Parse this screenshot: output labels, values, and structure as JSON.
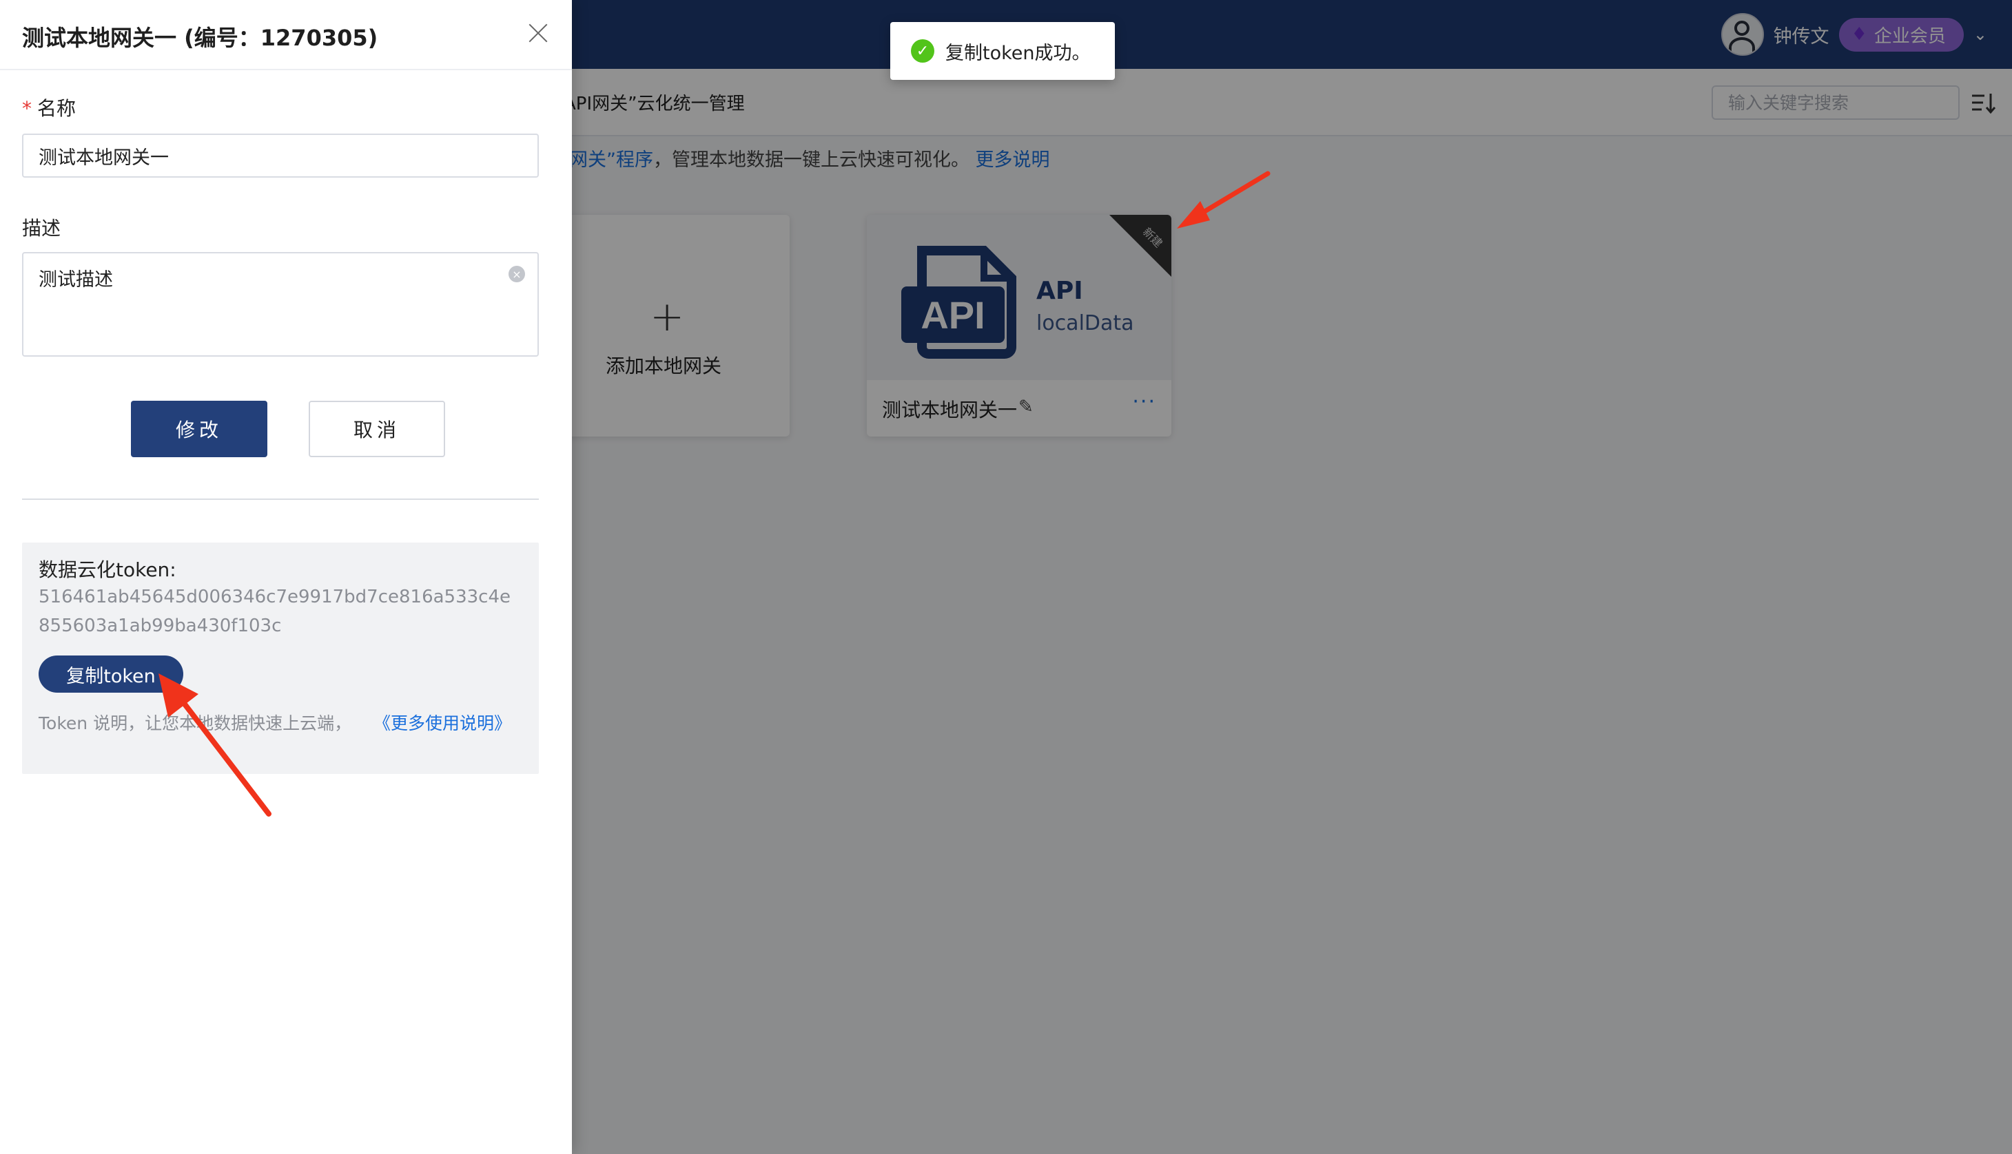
{
  "topbar": {
    "user_name": "钟传文",
    "vip_label": "企业会员",
    "colors": {
      "bar": "#1e3a73",
      "badge": "#8e67d9"
    }
  },
  "subbar": {
    "title": "API网关”云化统一管理",
    "search_placeholder": "输入关键字搜索"
  },
  "info": {
    "prefix": "I网关”程序",
    "text": "，管理本地数据一键上云快速可视化。",
    "link": "更多说明"
  },
  "cards": {
    "add_label": "添加本地网关",
    "gateway": {
      "api_title": "API",
      "api_subtitle": "localData",
      "logo_text": "API",
      "new_tag": "新建",
      "name": "测试本地网关一"
    }
  },
  "toast": {
    "message": "复制token成功。"
  },
  "drawer": {
    "title": "测试本地网关一 (编号：1270305)",
    "name_label": "名称",
    "name_value": "测试本地网关一",
    "desc_label": "描述",
    "desc_value": "测试描述",
    "submit_label": "修改",
    "cancel_label": "取消",
    "token": {
      "label": "数据云化token:",
      "value": "516461ab45645d006346c7e9917bd7ce816a533c4e855603a1ab99ba430f103c",
      "copy_label": "复制token",
      "note_left": "Token 说明，让您",
      "note_right": "本地数据快速上云端，",
      "note_link": "《更多使用说明》"
    }
  }
}
